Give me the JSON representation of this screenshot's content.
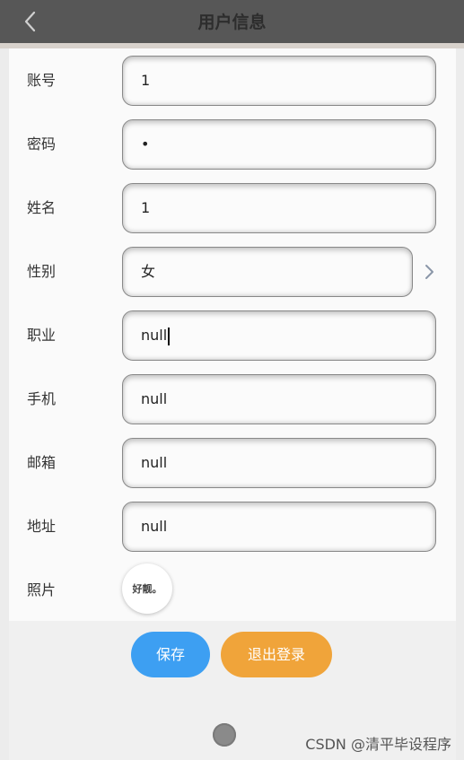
{
  "header": {
    "title": "用户信息",
    "back_icon": "chevron-left-icon"
  },
  "form": {
    "account": {
      "label": "账号",
      "value": "1"
    },
    "password": {
      "label": "密码",
      "value": "•"
    },
    "name": {
      "label": "姓名",
      "value": "1"
    },
    "gender": {
      "label": "性别",
      "value": "女"
    },
    "job": {
      "label": "职业",
      "value": "null"
    },
    "phone": {
      "label": "手机",
      "value": "null"
    },
    "email": {
      "label": "邮箱",
      "value": "null"
    },
    "address": {
      "label": "地址",
      "value": "null"
    },
    "photo": {
      "label": "照片",
      "image_text": "好靓。"
    }
  },
  "actions": {
    "save_label": "保存",
    "logout_label": "退出登录"
  },
  "watermark": "CSDN @清平毕设程序",
  "colors": {
    "save": "#3d9ff2",
    "logout": "#f0a43a",
    "header": "#575757"
  }
}
